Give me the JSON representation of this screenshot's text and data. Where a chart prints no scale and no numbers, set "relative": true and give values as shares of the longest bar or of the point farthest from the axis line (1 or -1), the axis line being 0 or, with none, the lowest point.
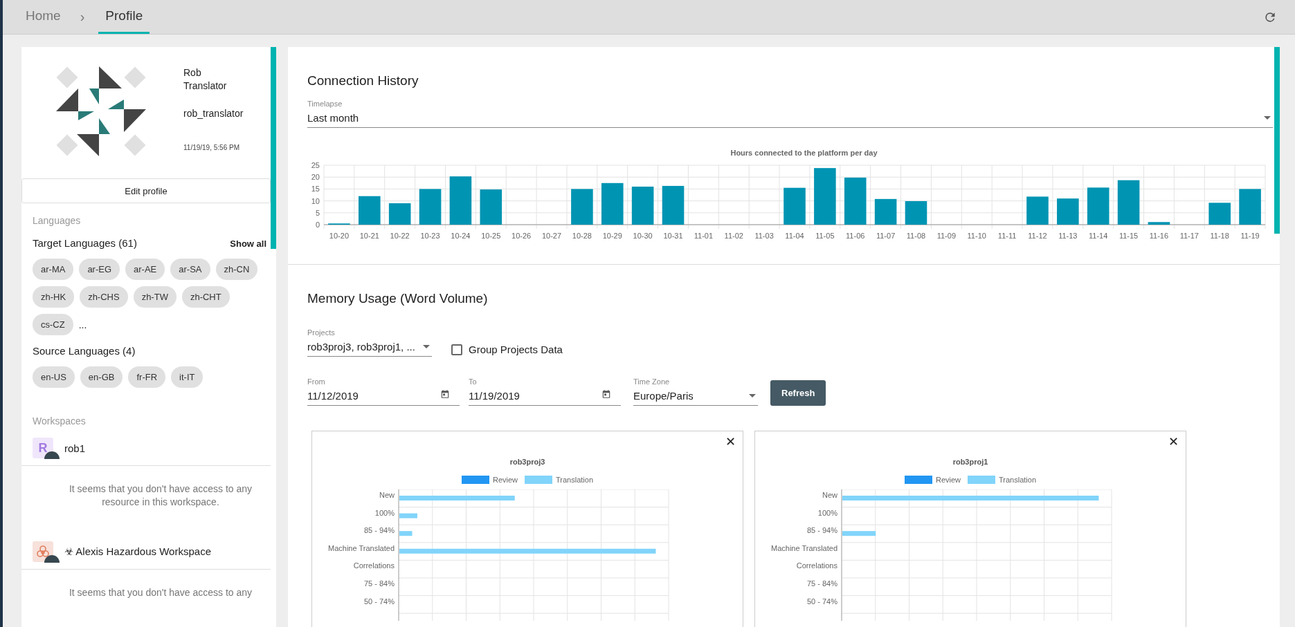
{
  "breadcrumb": [
    {
      "label": "Home",
      "selected": false
    },
    {
      "label": "Profile",
      "selected": true
    }
  ],
  "breadcrumb_separator": "›",
  "profile": {
    "name": "Rob Translator",
    "username": "rob_translator",
    "timestamp": "11/19/19, 5:56 PM",
    "edit_button": "Edit profile"
  },
  "languages": {
    "heading": "Languages",
    "target_title": "Target Languages (61)",
    "show_all": "Show all",
    "target": [
      "ar-MA",
      "ar-EG",
      "ar-AE",
      "ar-SA",
      "zh-CN",
      "zh-HK",
      "zh-CHS",
      "zh-TW",
      "zh-CHT",
      "cs-CZ"
    ],
    "more": "...",
    "source_title": "Source Languages (4)",
    "source": [
      "en-US",
      "en-GB",
      "fr-FR",
      "it-IT"
    ]
  },
  "workspaces": {
    "heading": "Workspaces",
    "items": [
      {
        "kind": "letter",
        "initial": "R",
        "name": "rob1",
        "message": "It seems that you don't have access to any resource in this workspace."
      },
      {
        "kind": "hazard",
        "name": "☣ Alexis Hazardous Workspace",
        "message": "It seems that you don't have access to any"
      }
    ]
  },
  "connection_history": {
    "title": "Connection History",
    "timelapse": {
      "label": "Timelapse",
      "value": "Last month"
    },
    "chart_data": {
      "type": "bar",
      "title": "Hours connected to the platform per day",
      "categories": [
        "10-20",
        "10-21",
        "10-22",
        "10-23",
        "10-24",
        "10-25",
        "10-26",
        "10-27",
        "10-28",
        "10-29",
        "10-30",
        "10-31",
        "11-01",
        "11-02",
        "11-03",
        "11-04",
        "11-05",
        "11-06",
        "11-07",
        "11-08",
        "11-09",
        "11-10",
        "11-11",
        "11-12",
        "11-13",
        "11-14",
        "11-15",
        "11-16",
        "11-17",
        "11-18",
        "11-19"
      ],
      "values": [
        0.5,
        12,
        9,
        15,
        20.3,
        14.8,
        0,
        0,
        15,
        17.5,
        16,
        16.3,
        0,
        0,
        0,
        15.5,
        23.8,
        19.8,
        10.8,
        9.9,
        0,
        0,
        0,
        11.8,
        11,
        15.6,
        18.7,
        1.1,
        0,
        9.2,
        15
      ],
      "ylim": [
        0,
        25
      ],
      "yticks": [
        0,
        5,
        10,
        15,
        20,
        25
      ],
      "grid": true
    }
  },
  "memory_usage": {
    "title": "Memory Usage (Word Volume)",
    "projects": {
      "label": "Projects",
      "value": "rob3proj3, rob3proj1, ..."
    },
    "group_projects": {
      "label": "Group Projects Data",
      "checked": false
    },
    "from": {
      "label": "From",
      "value": "11/12/2019"
    },
    "to": {
      "label": "To",
      "value": "11/19/2019"
    },
    "time_zone": {
      "label": "Time Zone",
      "value": "Europe/Paris"
    },
    "refresh_button": "Refresh",
    "charts": [
      {
        "close": "✕",
        "chart_data": {
          "type": "bar",
          "orientation": "horizontal",
          "relative": true,
          "grid": true,
          "title": "rob3proj3",
          "categories": [
            "New",
            "100%",
            "85 - 94%",
            "Machine Translated",
            "Correlations",
            "75 - 84%",
            "50 - 74%"
          ],
          "series": [
            {
              "name": "Review",
              "color": "#2196f3",
              "values": [
                null,
                null,
                null,
                null,
                null,
                null,
                null
              ]
            },
            {
              "name": "Translation",
              "color": "#81d4fa",
              "values": [
                0.45,
                0.07,
                0.05,
                1,
                0,
                0,
                0
              ]
            }
          ]
        }
      },
      {
        "close": "✕",
        "chart_data": {
          "type": "bar",
          "orientation": "horizontal",
          "relative": true,
          "grid": true,
          "title": "rob3proj1",
          "categories": [
            "New",
            "100%",
            "85 - 94%",
            "Machine Translated",
            "Correlations",
            "75 - 84%",
            "50 - 74%"
          ],
          "series": [
            {
              "name": "Review",
              "color": "#2196f3",
              "values": [
                null,
                null,
                null,
                null,
                null,
                null,
                null
              ]
            },
            {
              "name": "Translation",
              "color": "#81d4fa",
              "values": [
                1,
                0,
                0.13,
                0,
                0,
                0,
                0
              ]
            }
          ]
        }
      }
    ]
  }
}
